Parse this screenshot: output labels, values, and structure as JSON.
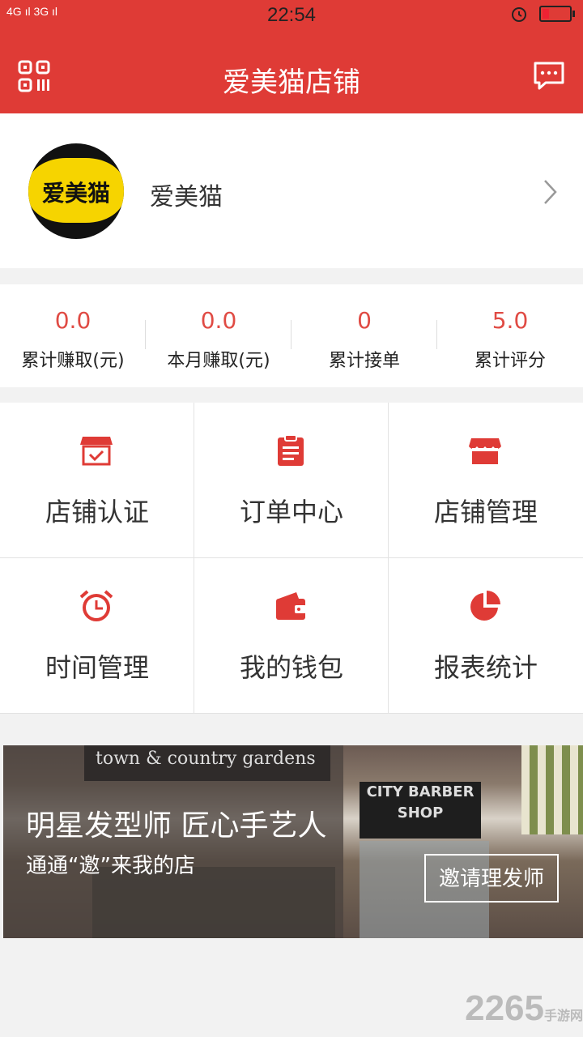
{
  "status_bar": {
    "left": "4G ıl 3G ıl",
    "time": "22:54"
  },
  "header": {
    "title": "爱美猫店铺",
    "left_icon": "qr-code-icon",
    "right_icon": "message-icon"
  },
  "profile": {
    "name": "爱美猫",
    "avatar_text": "爱美猫"
  },
  "stats": [
    {
      "value": "0.0",
      "label": "累计赚取(元)"
    },
    {
      "value": "0.0",
      "label": "本月赚取(元)"
    },
    {
      "value": "0",
      "label": "累计接单"
    },
    {
      "value": "5.0",
      "label": "累计评分"
    }
  ],
  "menu": [
    {
      "label": "店铺认证",
      "icon": "store-check-icon"
    },
    {
      "label": "订单中心",
      "icon": "clipboard-icon"
    },
    {
      "label": "店铺管理",
      "icon": "store-icon"
    },
    {
      "label": "时间管理",
      "icon": "alarm-clock-icon"
    },
    {
      "label": "我的钱包",
      "icon": "wallet-icon"
    },
    {
      "label": "报表统计",
      "icon": "pie-chart-icon"
    }
  ],
  "banner": {
    "title": "明星发型师 匠心手艺人",
    "subtitle": "通通“邀”来我的店",
    "button": "邀请理发师",
    "sign_left": "town & country gardens",
    "sign_right": "CITY BARBER SHOP"
  },
  "watermark": {
    "main": "2265",
    "sub": "手游网"
  },
  "colors": {
    "brand": "#df3b36",
    "accent_text": "#e04b44"
  }
}
